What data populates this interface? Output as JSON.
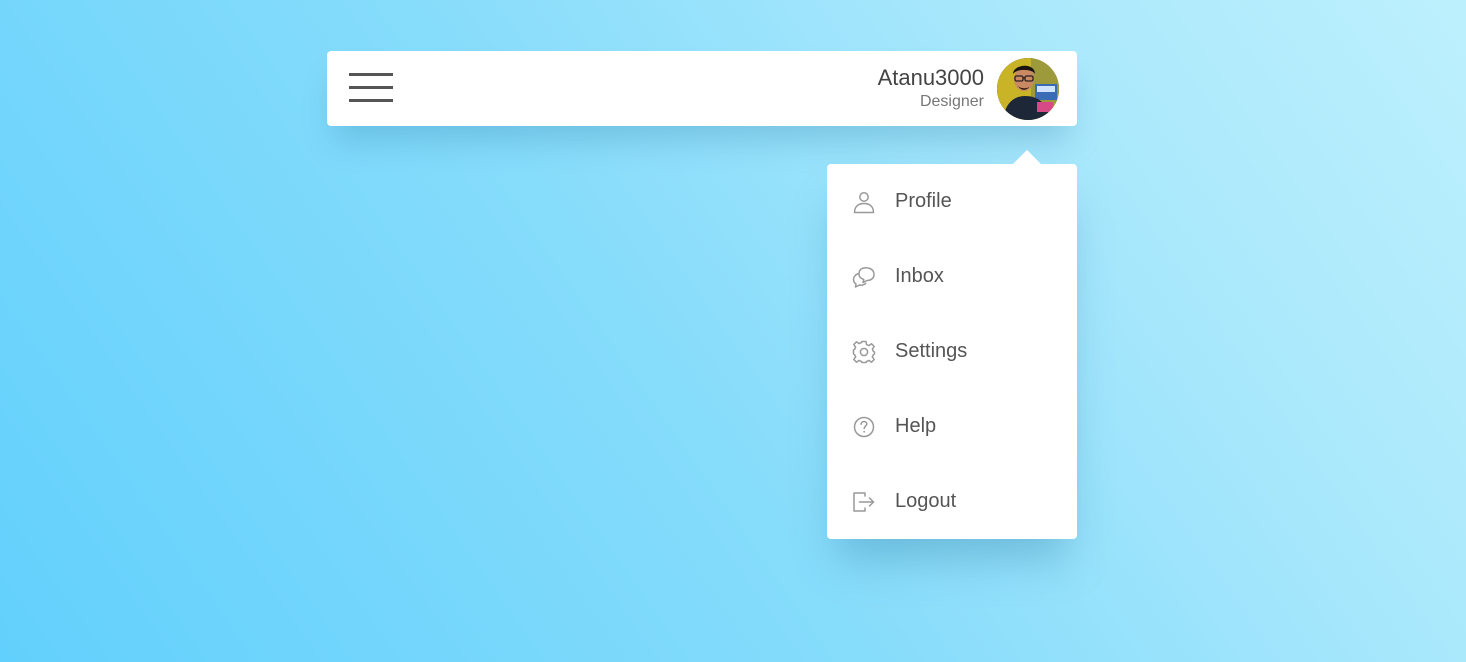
{
  "user": {
    "name": "Atanu3000",
    "role": "Designer"
  },
  "menu": {
    "items": [
      {
        "label": "Profile",
        "icon": "user-icon"
      },
      {
        "label": "Inbox",
        "icon": "chat-icon"
      },
      {
        "label": "Settings",
        "icon": "gear-icon"
      },
      {
        "label": "Help",
        "icon": "help-icon"
      },
      {
        "label": "Logout",
        "icon": "logout-icon"
      }
    ]
  },
  "colors": {
    "background_start": "#62d0fc",
    "background_end": "#bdf0fd",
    "card": "#ffffff",
    "text": "#555555",
    "icon": "#999999"
  }
}
